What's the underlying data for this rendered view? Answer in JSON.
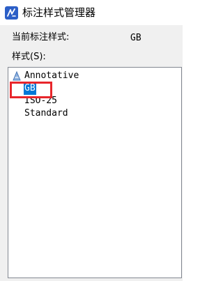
{
  "window": {
    "title": "标注样式管理器",
    "icon": "dimension-style-icon"
  },
  "current_style": {
    "label": "当前标注样式:",
    "value": "GB"
  },
  "styles": {
    "label": "样式(S):",
    "items": [
      {
        "label": "Annotative",
        "icon": "annotative-icon",
        "selected": false
      },
      {
        "label": "GB",
        "icon": "",
        "selected": true
      },
      {
        "label": "ISO-25",
        "icon": "",
        "selected": false
      },
      {
        "label": "Standard",
        "icon": "",
        "selected": false
      }
    ]
  },
  "colors": {
    "selection": "#0078d7",
    "highlight_box": "#e8262b",
    "title_icon": "#2c5fc7"
  }
}
